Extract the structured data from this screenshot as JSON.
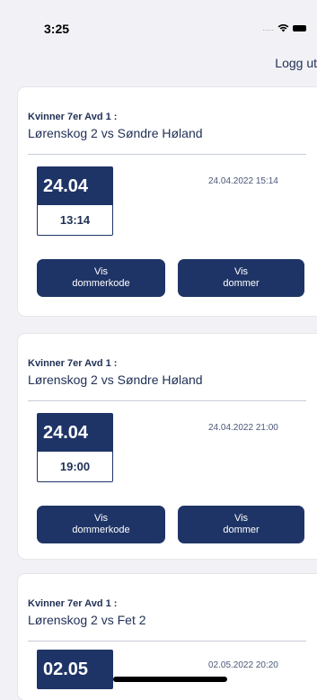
{
  "status": {
    "time": "3:25",
    "signal": "....."
  },
  "header": {
    "logout_label": "Logg ut"
  },
  "matches": [
    {
      "title": "Kvinner 7er Avd 1 :",
      "teams": "Lørenskog 2 vs Søndre Høland",
      "date": "24.04",
      "time": "13:14",
      "timestamp": "24.04.2022 15:14",
      "btn_code": [
        "Vis",
        "dommerkode"
      ],
      "btn_judge": [
        "Vis",
        "dommer"
      ]
    },
    {
      "title": "Kvinner 7er Avd 1 :",
      "teams": "Lørenskog 2 vs Søndre Høland",
      "date": "24.04",
      "time": "19:00",
      "timestamp": "24.04.2022 21:00",
      "btn_code": [
        "Vis",
        "dommerkode"
      ],
      "btn_judge": [
        "Vis",
        "dommer"
      ]
    },
    {
      "title": "Kvinner 7er Avd 1 :",
      "teams": "Lørenskog 2 vs Fet 2",
      "date": "02.05",
      "timestamp": "02.05.2022 20:20"
    }
  ],
  "colors": {
    "navy": "#1f3466",
    "text": "#1f2f55",
    "background": "#f2f2f6"
  },
  "icons": [
    "wifi-icon",
    "battery-icon"
  ]
}
